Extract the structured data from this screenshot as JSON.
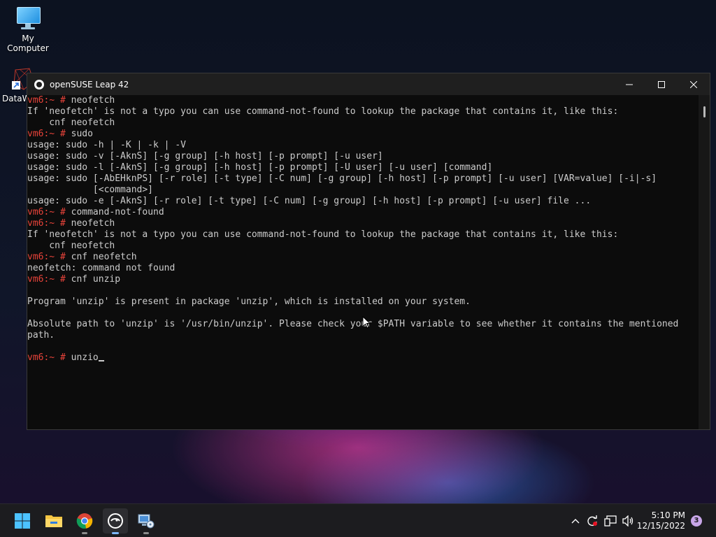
{
  "desktop": {
    "icons": [
      {
        "label": "My Computer",
        "icon": "monitor-icon"
      },
      {
        "label": "DataW",
        "icon": "shortcut-icon"
      }
    ]
  },
  "window": {
    "title": "openSUSE Leap 42",
    "controls": [
      "minimize",
      "maximize",
      "close"
    ]
  },
  "terminal": {
    "prompt": "vm6:~ #",
    "lines": [
      {
        "prompt": "vm6:~ #",
        "text": " neofetch"
      },
      {
        "text": "If 'neofetch' is not a typo you can use command-not-found to lookup the package that contains it, like this:"
      },
      {
        "text": "    cnf neofetch"
      },
      {
        "prompt": "vm6:~ #",
        "text": " sudo"
      },
      {
        "text": "usage: sudo -h | -K | -k | -V"
      },
      {
        "text": "usage: sudo -v [-AknS] [-g group] [-h host] [-p prompt] [-u user]"
      },
      {
        "text": "usage: sudo -l [-AknS] [-g group] [-h host] [-p prompt] [-U user] [-u user] [command]"
      },
      {
        "text": "usage: sudo [-AbEHknPS] [-r role] [-t type] [-C num] [-g group] [-h host] [-p prompt] [-u user] [VAR=value] [-i|-s]"
      },
      {
        "text": "            [<command>]"
      },
      {
        "text": "usage: sudo -e [-AknS] [-r role] [-t type] [-C num] [-g group] [-h host] [-p prompt] [-u user] file ..."
      },
      {
        "prompt": "vm6:~ #",
        "text": " command-not-found"
      },
      {
        "prompt": "vm6:~ #",
        "text": " neofetch"
      },
      {
        "text": "If 'neofetch' is not a typo you can use command-not-found to lookup the package that contains it, like this:"
      },
      {
        "text": "    cnf neofetch"
      },
      {
        "prompt": "vm6:~ #",
        "text": " cnf neofetch"
      },
      {
        "text": "neofetch: command not found"
      },
      {
        "prompt": "vm6:~ #",
        "text": " cnf unzip"
      },
      {
        "text": ""
      },
      {
        "text": "Program 'unzip' is present in package 'unzip', which is installed on your system."
      },
      {
        "text": ""
      },
      {
        "text": "Absolute path to 'unzip' is '/usr/bin/unzip'. Please check your $PATH variable to see whether it contains the mentioned"
      },
      {
        "text": "path."
      },
      {
        "text": ""
      }
    ],
    "current_input": " unzio",
    "colors": {
      "prompt": "#e8433a",
      "text": "#cccccc",
      "background": "#0c0c0c"
    }
  },
  "taskbar": {
    "apps": [
      {
        "name": "start",
        "icon": "windows-start-icon"
      },
      {
        "name": "file-explorer",
        "icon": "folder-icon"
      },
      {
        "name": "chrome",
        "icon": "chrome-icon"
      },
      {
        "name": "opensuse-terminal",
        "icon": "opensuse-icon",
        "active": true
      },
      {
        "name": "network-app",
        "icon": "network-computer-icon"
      }
    ],
    "tray": {
      "icons": [
        "chevron-up-icon",
        "sync-icon",
        "network-icon",
        "volume-icon"
      ],
      "time": "5:10 PM",
      "date": "12/15/2022",
      "notification_count": "3"
    }
  }
}
